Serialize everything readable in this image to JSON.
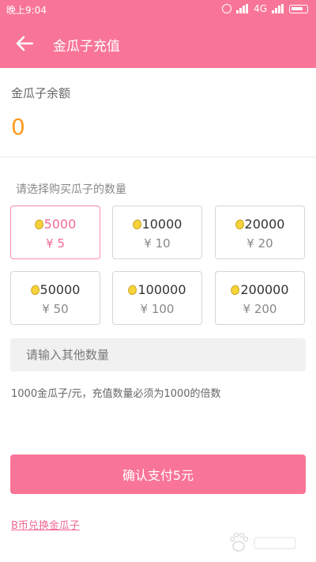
{
  "status_bar": {
    "time": "晚上9:04",
    "network": "4G"
  },
  "header": {
    "title": "金瓜子充值",
    "back_icon": "arrow-left-icon"
  },
  "balance": {
    "label": "金瓜子余额",
    "value": "0"
  },
  "packages": {
    "label": "请选择购买瓜子的数量",
    "selected_index": 0,
    "items": [
      {
        "amount": "5000",
        "price": "¥ 5"
      },
      {
        "amount": "10000",
        "price": "¥ 10"
      },
      {
        "amount": "20000",
        "price": "¥ 20"
      },
      {
        "amount": "50000",
        "price": "¥ 50"
      },
      {
        "amount": "100000",
        "price": "¥ 100"
      },
      {
        "amount": "200000",
        "price": "¥ 200"
      }
    ]
  },
  "other_amount": {
    "placeholder": "请输入其他数量",
    "value": ""
  },
  "rule_text": "1000金瓜子/元，充值数量必须为1000的倍数",
  "pay_button": "确认支付5元",
  "exchange_link": "B币兑换金瓜子",
  "colors": {
    "accent": "#f97598",
    "balance": "#ff9a1f",
    "selected": "#f06a92"
  }
}
